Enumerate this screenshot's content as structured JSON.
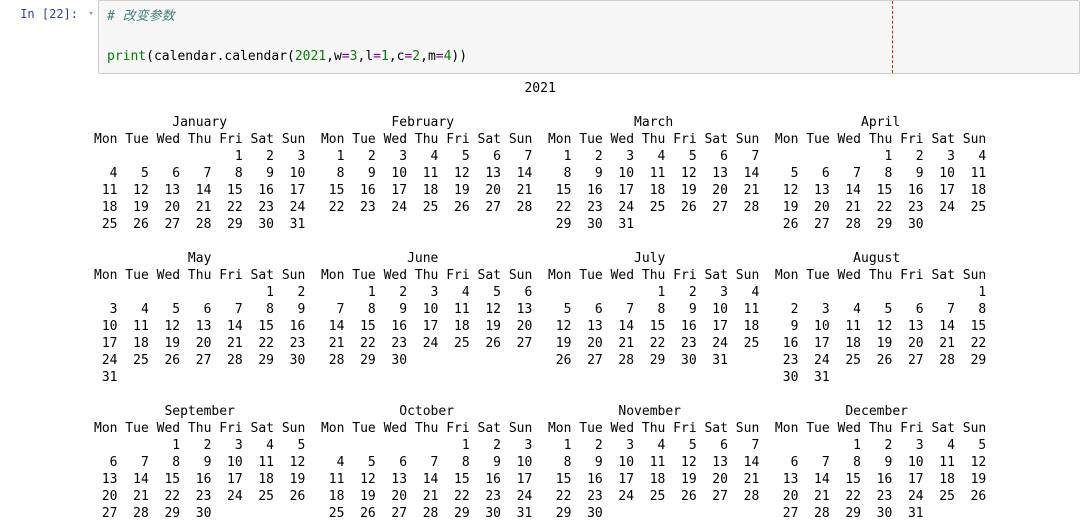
{
  "cell": {
    "prompt_label": "In [22]:",
    "code": {
      "comment": "# 改变参数",
      "line2_prefix": "print",
      "line2_mid": "(calendar.calendar(",
      "year": "2021",
      "sep": ",",
      "k_w": "w",
      "eq": "=",
      "v_w": "3",
      "k_l": "l",
      "v_l": "1",
      "k_c": "c",
      "v_c": "2",
      "k_m": "m",
      "v_m": "4",
      "line2_suffix": "))"
    }
  },
  "chart_data": {
    "type": "table",
    "title": "2021",
    "row_groups": [
      {
        "months": [
          {
            "name": "January",
            "weeks": [
              [
                "",
                "",
                "",
                "",
                "1",
                "2",
                "3"
              ],
              [
                "4",
                "5",
                "6",
                "7",
                "8",
                "9",
                "10"
              ],
              [
                "11",
                "12",
                "13",
                "14",
                "15",
                "16",
                "17"
              ],
              [
                "18",
                "19",
                "20",
                "21",
                "22",
                "23",
                "24"
              ],
              [
                "25",
                "26",
                "27",
                "28",
                "29",
                "30",
                "31"
              ]
            ]
          },
          {
            "name": "February",
            "weeks": [
              [
                "1",
                "2",
                "3",
                "4",
                "5",
                "6",
                "7"
              ],
              [
                "8",
                "9",
                "10",
                "11",
                "12",
                "13",
                "14"
              ],
              [
                "15",
                "16",
                "17",
                "18",
                "19",
                "20",
                "21"
              ],
              [
                "22",
                "23",
                "24",
                "25",
                "26",
                "27",
                "28"
              ]
            ]
          },
          {
            "name": "March",
            "weeks": [
              [
                "1",
                "2",
                "3",
                "4",
                "5",
                "6",
                "7"
              ],
              [
                "8",
                "9",
                "10",
                "11",
                "12",
                "13",
                "14"
              ],
              [
                "15",
                "16",
                "17",
                "18",
                "19",
                "20",
                "21"
              ],
              [
                "22",
                "23",
                "24",
                "25",
                "26",
                "27",
                "28"
              ],
              [
                "29",
                "30",
                "31",
                "",
                "",
                "",
                ""
              ]
            ]
          },
          {
            "name": "April",
            "weeks": [
              [
                "",
                "",
                "",
                "1",
                "2",
                "3",
                "4"
              ],
              [
                "5",
                "6",
                "7",
                "8",
                "9",
                "10",
                "11"
              ],
              [
                "12",
                "13",
                "14",
                "15",
                "16",
                "17",
                "18"
              ],
              [
                "19",
                "20",
                "21",
                "22",
                "23",
                "24",
                "25"
              ],
              [
                "26",
                "27",
                "28",
                "29",
                "30",
                "",
                ""
              ]
            ]
          }
        ]
      },
      {
        "months": [
          {
            "name": "May",
            "weeks": [
              [
                "",
                "",
                "",
                "",
                "",
                "1",
                "2"
              ],
              [
                "3",
                "4",
                "5",
                "6",
                "7",
                "8",
                "9"
              ],
              [
                "10",
                "11",
                "12",
                "13",
                "14",
                "15",
                "16"
              ],
              [
                "17",
                "18",
                "19",
                "20",
                "21",
                "22",
                "23"
              ],
              [
                "24",
                "25",
                "26",
                "27",
                "28",
                "29",
                "30"
              ],
              [
                "31",
                "",
                "",
                "",
                "",
                "",
                ""
              ]
            ]
          },
          {
            "name": "June",
            "weeks": [
              [
                "",
                "1",
                "2",
                "3",
                "4",
                "5",
                "6"
              ],
              [
                "7",
                "8",
                "9",
                "10",
                "11",
                "12",
                "13"
              ],
              [
                "14",
                "15",
                "16",
                "17",
                "18",
                "19",
                "20"
              ],
              [
                "21",
                "22",
                "23",
                "24",
                "25",
                "26",
                "27"
              ],
              [
                "28",
                "29",
                "30",
                "",
                "",
                "",
                ""
              ]
            ]
          },
          {
            "name": "July",
            "weeks": [
              [
                "",
                "",
                "",
                "1",
                "2",
                "3",
                "4"
              ],
              [
                "5",
                "6",
                "7",
                "8",
                "9",
                "10",
                "11"
              ],
              [
                "12",
                "13",
                "14",
                "15",
                "16",
                "17",
                "18"
              ],
              [
                "19",
                "20",
                "21",
                "22",
                "23",
                "24",
                "25"
              ],
              [
                "26",
                "27",
                "28",
                "29",
                "30",
                "31",
                ""
              ]
            ]
          },
          {
            "name": "August",
            "weeks": [
              [
                "",
                "",
                "",
                "",
                "",
                "",
                "1"
              ],
              [
                "2",
                "3",
                "4",
                "5",
                "6",
                "7",
                "8"
              ],
              [
                "9",
                "10",
                "11",
                "12",
                "13",
                "14",
                "15"
              ],
              [
                "16",
                "17",
                "18",
                "19",
                "20",
                "21",
                "22"
              ],
              [
                "23",
                "24",
                "25",
                "26",
                "27",
                "28",
                "29"
              ],
              [
                "30",
                "31",
                "",
                "",
                "",
                "",
                ""
              ]
            ]
          }
        ]
      },
      {
        "months": [
          {
            "name": "September",
            "weeks": [
              [
                "",
                "",
                "1",
                "2",
                "3",
                "4",
                "5"
              ],
              [
                "6",
                "7",
                "8",
                "9",
                "10",
                "11",
                "12"
              ],
              [
                "13",
                "14",
                "15",
                "16",
                "17",
                "18",
                "19"
              ],
              [
                "20",
                "21",
                "22",
                "23",
                "24",
                "25",
                "26"
              ],
              [
                "27",
                "28",
                "29",
                "30",
                "",
                "",
                ""
              ]
            ]
          },
          {
            "name": "October",
            "weeks": [
              [
                "",
                "",
                "",
                "",
                "1",
                "2",
                "3"
              ],
              [
                "4",
                "5",
                "6",
                "7",
                "8",
                "9",
                "10"
              ],
              [
                "11",
                "12",
                "13",
                "14",
                "15",
                "16",
                "17"
              ],
              [
                "18",
                "19",
                "20",
                "21",
                "22",
                "23",
                "24"
              ],
              [
                "25",
                "26",
                "27",
                "28",
                "29",
                "30",
                "31"
              ]
            ]
          },
          {
            "name": "November",
            "weeks": [
              [
                "1",
                "2",
                "3",
                "4",
                "5",
                "6",
                "7"
              ],
              [
                "8",
                "9",
                "10",
                "11",
                "12",
                "13",
                "14"
              ],
              [
                "15",
                "16",
                "17",
                "18",
                "19",
                "20",
                "21"
              ],
              [
                "22",
                "23",
                "24",
                "25",
                "26",
                "27",
                "28"
              ],
              [
                "29",
                "30",
                "",
                "",
                "",
                "",
                ""
              ]
            ]
          },
          {
            "name": "December",
            "weeks": [
              [
                "",
                "",
                "1",
                "2",
                "3",
                "4",
                "5"
              ],
              [
                "6",
                "7",
                "8",
                "9",
                "10",
                "11",
                "12"
              ],
              [
                "13",
                "14",
                "15",
                "16",
                "17",
                "18",
                "19"
              ],
              [
                "20",
                "21",
                "22",
                "23",
                "24",
                "25",
                "26"
              ],
              [
                "27",
                "28",
                "29",
                "30",
                "31",
                "",
                ""
              ]
            ]
          }
        ]
      }
    ],
    "day_header": [
      "Mon",
      "Tue",
      "Wed",
      "Thu",
      "Fri",
      "Sat",
      "Sun"
    ],
    "params": {
      "w": 3,
      "l": 1,
      "c": 2,
      "m": 4
    }
  }
}
